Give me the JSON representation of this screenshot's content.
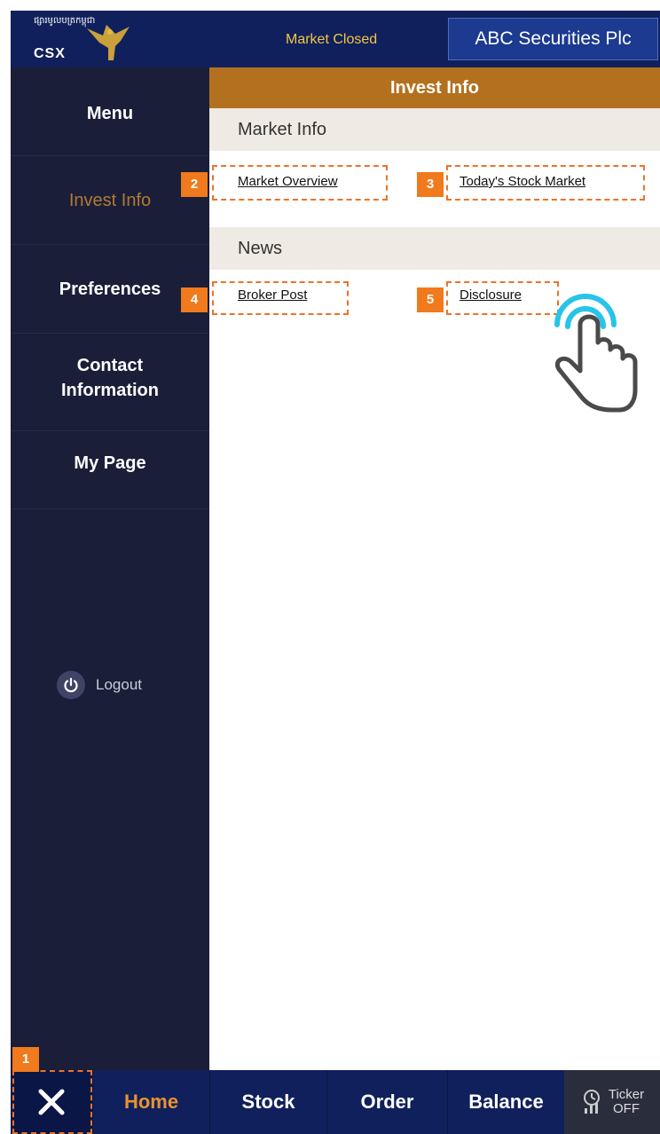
{
  "header": {
    "logo_khmer": "ផ្សារមូលបត្រកម្ពុជា",
    "logo_text": "CSX",
    "market_status": "Market Closed",
    "broker_name": "ABC Securities Plc"
  },
  "sidebar": {
    "items": [
      {
        "label": "Menu"
      },
      {
        "label": "Invest Info"
      },
      {
        "label": "Preferences"
      },
      {
        "label": "Contact Information"
      },
      {
        "label": "My Page"
      }
    ],
    "logout_label": "Logout"
  },
  "main": {
    "title": "Invest Info",
    "sections": [
      {
        "title": "Market Info",
        "links": [
          "Market Overview",
          "Today's Stock Market"
        ]
      },
      {
        "title": "News",
        "links": [
          "Broker Post",
          "Disclosure"
        ]
      }
    ]
  },
  "annotations": [
    "1",
    "2",
    "3",
    "4",
    "5"
  ],
  "bottom_nav": {
    "close_icon": "close-icon",
    "tabs": [
      "Home",
      "Stock",
      "Order",
      "Balance"
    ],
    "ticker_label": "Ticker",
    "ticker_state": "OFF"
  },
  "colors": {
    "header_bg": "#10205c",
    "sidebar_bg": "#1b1e38",
    "accent_orange": "#b3711f",
    "active_tab": "#e8932f",
    "annotation": "#f07a1c",
    "gesture_cyan": "#28c4e8"
  },
  "icons": [
    "csx-bird-logo",
    "power-icon",
    "close-icon",
    "ticker-icon",
    "tap-hand-icon"
  ]
}
